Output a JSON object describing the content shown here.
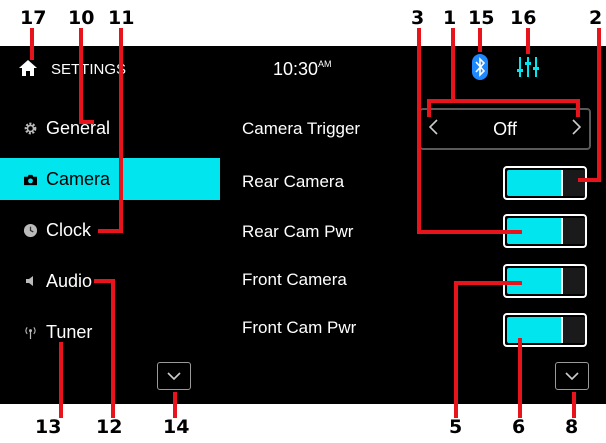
{
  "header": {
    "title": "SETTINGS",
    "time": "10:30",
    "ampm": "AM",
    "home_icon": "home-icon",
    "bluetooth_icon": "bluetooth-icon",
    "equalizer_icon": "equalizer-icon"
  },
  "sidebar": {
    "items": [
      {
        "label": "General",
        "icon": "gear-icon",
        "active": false
      },
      {
        "label": "Camera",
        "icon": "camera-icon",
        "active": true
      },
      {
        "label": "Clock",
        "icon": "clock-icon",
        "active": false
      },
      {
        "label": "Audio",
        "icon": "speaker-icon",
        "active": false
      },
      {
        "label": "Tuner",
        "icon": "radio-icon",
        "active": false
      }
    ],
    "scroll_icon": "chevron-down-icon"
  },
  "main": {
    "rows": [
      {
        "label": "Camera Trigger",
        "type": "selector",
        "value": "Off"
      },
      {
        "label": "Rear Camera",
        "type": "toggle",
        "on": true
      },
      {
        "label": "Rear Cam Pwr",
        "type": "toggle",
        "on": true
      },
      {
        "label": "Front Camera",
        "type": "toggle",
        "on": true
      },
      {
        "label": "Front Cam Pwr",
        "type": "toggle",
        "on": true
      }
    ],
    "scroll_icon": "chevron-down-icon"
  },
  "callouts": [
    "17",
    "10",
    "11",
    "3",
    "1",
    "15",
    "16",
    "2",
    "13",
    "12",
    "14",
    "5",
    "6",
    "8"
  ],
  "colors": {
    "accent": "#00e5ee",
    "background": "#000000",
    "bluetooth": "#1e88ff",
    "callout_line": "#e8141c"
  }
}
